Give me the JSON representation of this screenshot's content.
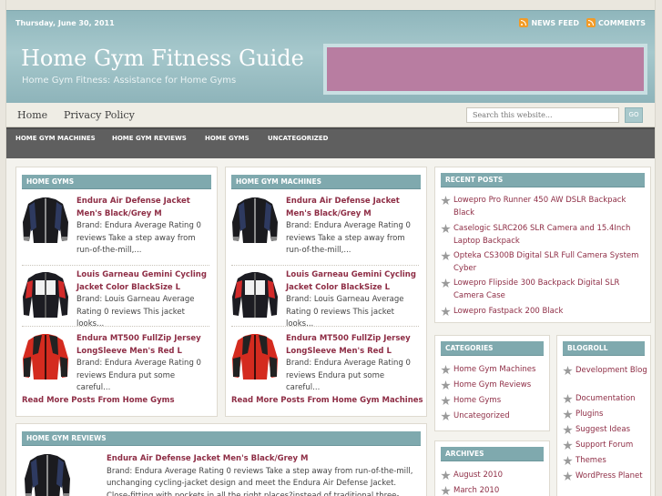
{
  "header": {
    "date": "Thursday, June 30, 2011",
    "news_feed": "NEWS FEED",
    "comments": "COMMENTS",
    "site_title": "Home Gym Fitness Guide",
    "tagline": "Home Gym Fitness: Assistance for Home Gyms"
  },
  "nav": {
    "pages": [
      "Home",
      "Privacy Policy"
    ],
    "search_placeholder": "Search this website...",
    "go": "GO",
    "categories": [
      "HOME GYM MACHINES",
      "HOME GYM REVIEWS",
      "HOME GYMS",
      "UNCATEGORIZED"
    ]
  },
  "sections": [
    {
      "heading": "HOME GYMS",
      "posts": [
        {
          "title": "Endura Air Defense Jacket Men's Black/Grey M",
          "excerpt": "Brand: Endura Average Rating 0 reviews Take a step away from run-of-the-mill,..."
        },
        {
          "title": "Louis Garneau Gemini Cycling Jacket Color BlackSize L",
          "excerpt": "Brand: Louis Garneau Average Rating 0 reviews This jacket looks..."
        },
        {
          "title": "Endura MT500 FullZip Jersey LongSleeve Men's Red L",
          "excerpt": "Brand: Endura Average Rating 0 reviews Endura put some careful..."
        }
      ],
      "more": "Read More Posts From Home Gyms"
    },
    {
      "heading": "HOME GYM MACHINES",
      "posts": [
        {
          "title": "Endura Air Defense Jacket Men's Black/Grey M",
          "excerpt": "Brand: Endura Average Rating 0 reviews Take a step away from run-of-the-mill,..."
        },
        {
          "title": "Louis Garneau Gemini Cycling Jacket Color BlackSize L",
          "excerpt": "Brand: Louis Garneau Average Rating 0 reviews This jacket looks..."
        },
        {
          "title": "Endura MT500 FullZip Jersey LongSleeve Men's Red L",
          "excerpt": "Brand: Endura Average Rating 0 reviews Endura put some careful..."
        }
      ],
      "more": "Read More Posts From Home Gym Machines"
    }
  ],
  "reviews": {
    "heading": "HOME GYM REVIEWS",
    "title": "Endura Air Defense Jacket Men's Black/Grey M",
    "excerpt": "Brand: Endura Average Rating 0 reviews Take a step away from run-of-the-mill, unchanging cycling-jacket design and meet the Endura Air Defense Jacket. Close-fitting with pockets in all the right places?instead of traditional three-pocket rear"
  },
  "sidebar": {
    "recent_heading": "RECENT POSTS",
    "recent": [
      "Lowepro Pro Runner 450 AW DSLR Backpack Black",
      "Caselogic SLRC206 SLR Camera and 15.4Inch Laptop Backpack",
      "Opteka CS300B Digital SLR Full Camera System Cyber",
      "Lowepro Flipside 300 Backpack Digital SLR Camera Case",
      "Lowepro Fastpack 200 Black"
    ],
    "categories_heading": "CATEGORIES",
    "categories": [
      "Home Gym Machines",
      "Home Gym Reviews",
      "Home Gyms",
      "Uncategorized"
    ],
    "blogroll_heading": "BLOGROLL",
    "blogroll": [
      "Development Blog",
      "Documentation",
      "Plugins",
      "Suggest Ideas",
      "Support Forum",
      "Themes",
      "WordPress Planet"
    ],
    "archives_heading": "ARCHIVES",
    "archives": [
      "August 2010",
      "March 2010"
    ]
  },
  "colors": {
    "accent": "#7fa9ae",
    "link": "#8e2d45",
    "navbar": "#5f5f5f",
    "banner": "#b87da1"
  }
}
